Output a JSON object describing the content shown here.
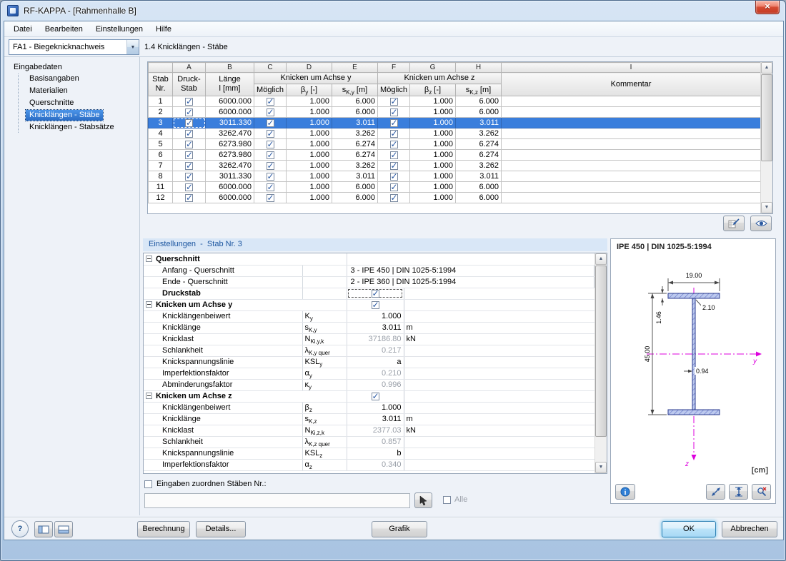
{
  "window": {
    "title": "RF-KAPPA - [Rahmenhalle B]"
  },
  "menu": {
    "items": [
      "Datei",
      "Bearbeiten",
      "Einstellungen",
      "Hilfe"
    ]
  },
  "toolbar": {
    "case_selector": "FA1 - Biegeknicknachweis",
    "page_title": "1.4 Knicklängen - Stäbe"
  },
  "sidebar": {
    "root": "Eingabedaten",
    "items": [
      "Basisangaben",
      "Materialien",
      "Querschnitte",
      "Knicklängen - Stäbe",
      "Knicklängen - Stabsätze"
    ],
    "selected_index": 3
  },
  "table": {
    "column_letters": [
      "A",
      "B",
      "C",
      "D",
      "E",
      "F",
      "G",
      "H",
      "I"
    ],
    "headers": {
      "stab_1": "Stab",
      "stab_2": "Nr.",
      "druck_1": "Druck-",
      "druck_2": "Stab",
      "laenge_1": "Länge",
      "laenge_2": "l [mm]",
      "knicken_y": "Knicken um Achse y",
      "knicken_z": "Knicken um Achse z",
      "moeglich": "Möglich",
      "beta_y": "β~y~ [-]",
      "sk_y": "s~K,y~ [m]",
      "beta_z": "β~z~ [-]",
      "sk_z": "s~K,z~ [m]",
      "kommentar": "Kommentar"
    },
    "selected_nr": "3",
    "rows": [
      {
        "nr": "1",
        "druck": true,
        "laenge": "6000.000",
        "moeglich_y": true,
        "beta_y": "1.000",
        "sk_y": "6.000",
        "moeglich_z": true,
        "beta_z": "1.000",
        "sk_z": "6.000",
        "kommentar": ""
      },
      {
        "nr": "2",
        "druck": true,
        "laenge": "6000.000",
        "moeglich_y": true,
        "beta_y": "1.000",
        "sk_y": "6.000",
        "moeglich_z": true,
        "beta_z": "1.000",
        "sk_z": "6.000",
        "kommentar": ""
      },
      {
        "nr": "3",
        "druck": true,
        "laenge": "3011.330",
        "moeglich_y": true,
        "beta_y": "1.000",
        "sk_y": "3.011",
        "moeglich_z": true,
        "beta_z": "1.000",
        "sk_z": "3.011",
        "kommentar": ""
      },
      {
        "nr": "4",
        "druck": true,
        "laenge": "3262.470",
        "moeglich_y": true,
        "beta_y": "1.000",
        "sk_y": "3.262",
        "moeglich_z": true,
        "beta_z": "1.000",
        "sk_z": "3.262",
        "kommentar": ""
      },
      {
        "nr": "5",
        "druck": true,
        "laenge": "6273.980",
        "moeglich_y": true,
        "beta_y": "1.000",
        "sk_y": "6.274",
        "moeglich_z": true,
        "beta_z": "1.000",
        "sk_z": "6.274",
        "kommentar": ""
      },
      {
        "nr": "6",
        "druck": true,
        "laenge": "6273.980",
        "moeglich_y": true,
        "beta_y": "1.000",
        "sk_y": "6.274",
        "moeglich_z": true,
        "beta_z": "1.000",
        "sk_z": "6.274",
        "kommentar": ""
      },
      {
        "nr": "7",
        "druck": true,
        "laenge": "3262.470",
        "moeglich_y": true,
        "beta_y": "1.000",
        "sk_y": "3.262",
        "moeglich_z": true,
        "beta_z": "1.000",
        "sk_z": "3.262",
        "kommentar": ""
      },
      {
        "nr": "8",
        "druck": true,
        "laenge": "3011.330",
        "moeglich_y": true,
        "beta_y": "1.000",
        "sk_y": "3.011",
        "moeglich_z": true,
        "beta_z": "1.000",
        "sk_z": "3.011",
        "kommentar": ""
      },
      {
        "nr": "11",
        "druck": true,
        "laenge": "6000.000",
        "moeglich_y": true,
        "beta_y": "1.000",
        "sk_y": "6.000",
        "moeglich_z": true,
        "beta_z": "1.000",
        "sk_z": "6.000",
        "kommentar": ""
      },
      {
        "nr": "12",
        "druck": true,
        "laenge": "6000.000",
        "moeglich_y": true,
        "beta_y": "1.000",
        "sk_y": "6.000",
        "moeglich_z": true,
        "beta_z": "1.000",
        "sk_z": "6.000",
        "kommentar": ""
      }
    ]
  },
  "settings": {
    "title": "Einstellungen  -  Stab Nr. 3",
    "rows": [
      {
        "type": "group",
        "label": "Querschnitt"
      },
      {
        "type": "item",
        "label": "Anfang - Querschnitt",
        "symbol": "",
        "value": "3 - IPE 450 | DIN 1025-5:1994",
        "long": true
      },
      {
        "type": "item",
        "label": "Ende - Querschnitt",
        "symbol": "",
        "value": "2 - IPE 360 | DIN 1025-5:1994",
        "long": true
      },
      {
        "type": "checkbox",
        "label": "Druckstab",
        "checked": true,
        "focused": true
      },
      {
        "type": "group_checkbox",
        "label": "Knicken um Achse y",
        "checked": true
      },
      {
        "type": "item",
        "label": "Knicklängenbeiwert",
        "symbol": "K~y~",
        "value": "1.000"
      },
      {
        "type": "item",
        "label": "Knicklänge",
        "symbol": "s~K,y~",
        "value": "3.011",
        "unit": "m"
      },
      {
        "type": "item",
        "label": "Knicklast",
        "symbol": "N~Ki,y,k~",
        "value": "37186.80",
        "unit": "kN",
        "readonly": true
      },
      {
        "type": "item",
        "label": "Schlankheit",
        "symbol": "λ~K,y quer~",
        "value": "0.217",
        "readonly": true
      },
      {
        "type": "item",
        "label": "Knickspannungslinie",
        "symbol": "KSL~y~",
        "value": "a"
      },
      {
        "type": "item",
        "label": "Imperfektionsfaktor",
        "symbol": "α~y~",
        "value": "0.210",
        "readonly": true
      },
      {
        "type": "item",
        "label": "Abminderungsfaktor",
        "symbol": "κ~y~",
        "value": "0.996",
        "readonly": true
      },
      {
        "type": "group_checkbox",
        "label": "Knicken um Achse z",
        "checked": true
      },
      {
        "type": "item",
        "label": "Knicklängenbeiwert",
        "symbol": "β~z~",
        "value": "1.000"
      },
      {
        "type": "item",
        "label": "Knicklänge",
        "symbol": "s~K,z~",
        "value": "3.011",
        "unit": "m"
      },
      {
        "type": "item",
        "label": "Knicklast",
        "symbol": "N~Ki,z,k~",
        "value": "2377.03",
        "unit": "kN",
        "readonly": true
      },
      {
        "type": "item",
        "label": "Schlankheit",
        "symbol": "λ~K,z quer~",
        "value": "0.857",
        "readonly": true
      },
      {
        "type": "item",
        "label": "Knickspannungslinie",
        "symbol": "KSL~z~",
        "value": "b"
      },
      {
        "type": "item",
        "label": "Imperfektionsfaktor",
        "symbol": "α~z~",
        "value": "0.340",
        "readonly": true
      }
    ],
    "assign_label": "Eingaben zuordnen Stäben Nr.:",
    "assign_value": "",
    "alle_label": "Alle"
  },
  "section_panel": {
    "title": "IPE 450 | DIN 1025-5:1994",
    "dim_width": "19.00",
    "dim_flange": "1.46",
    "dim_radius": "2.10",
    "dim_height": "45.00",
    "dim_web": "0.94",
    "axis_y": "y",
    "axis_z": "z",
    "unit": "[cm]"
  },
  "footer": {
    "help": "?",
    "berechnung": "Berechnung",
    "details": "Details...",
    "grafik": "Grafik",
    "ok": "OK",
    "abbrechen": "Abbrechen"
  },
  "colors": {
    "selection_blue": "#3a7edc",
    "column_highlight": "#f2b45c",
    "axis_magenta": "#dd00dd",
    "section_fill": "#bcc9ee"
  }
}
